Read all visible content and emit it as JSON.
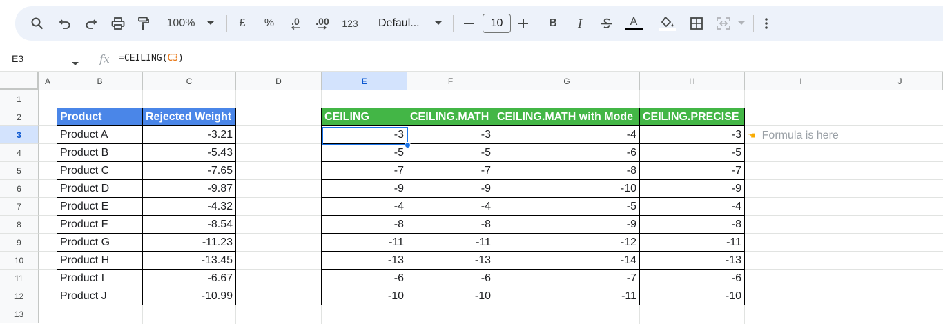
{
  "toolbar": {
    "zoom": "100%",
    "currency": "£",
    "percent": "%",
    "decrease_decimal": ".0",
    "increase_decimal": ".00",
    "number_format": "123",
    "font": "Defaul...",
    "font_size": "10",
    "bold": "B",
    "italic": "I",
    "text_color": "A"
  },
  "formula_bar": {
    "cell_ref": "E3",
    "formula_prefix": "=CEILING(",
    "formula_ref": "C3",
    "formula_suffix": ")"
  },
  "columns": [
    "A",
    "B",
    "C",
    "D",
    "E",
    "F",
    "G",
    "H",
    "I",
    "J"
  ],
  "rows": [
    "1",
    "2",
    "3",
    "4",
    "5",
    "6",
    "7",
    "8",
    "9",
    "10",
    "11",
    "12",
    "13"
  ],
  "left_table": {
    "headers": [
      "Product",
      "Rejected Weight"
    ],
    "rows": [
      [
        "Product A",
        "-3.21"
      ],
      [
        "Product B",
        "-5.43"
      ],
      [
        "Product C",
        "-7.65"
      ],
      [
        "Product D",
        "-9.87"
      ],
      [
        "Product E",
        "-4.32"
      ],
      [
        "Product F",
        "-8.54"
      ],
      [
        "Product G",
        "-11.23"
      ],
      [
        "Product H",
        "-13.45"
      ],
      [
        "Product I",
        "-6.67"
      ],
      [
        "Product J",
        "-10.99"
      ]
    ]
  },
  "right_table": {
    "headers": [
      "CEILING",
      "CEILING.MATH",
      "CEILING.MATH with Mode",
      "CEILING.PRECISE"
    ],
    "rows": [
      [
        "-3",
        "-3",
        "-4",
        "-3"
      ],
      [
        "-5",
        "-5",
        "-6",
        "-5"
      ],
      [
        "-7",
        "-7",
        "-8",
        "-7"
      ],
      [
        "-9",
        "-9",
        "-10",
        "-9"
      ],
      [
        "-4",
        "-4",
        "-5",
        "-4"
      ],
      [
        "-8",
        "-8",
        "-9",
        "-8"
      ],
      [
        "-11",
        "-11",
        "-12",
        "-11"
      ],
      [
        "-13",
        "-13",
        "-14",
        "-13"
      ],
      [
        "-6",
        "-6",
        "-7",
        "-6"
      ],
      [
        "-10",
        "-10",
        "-11",
        "-10"
      ]
    ]
  },
  "note": {
    "hand_icon": "pointing-hand-icon",
    "text": "Formula is here"
  },
  "colors": {
    "header_blue": "#4a86e8",
    "header_green": "#43b646",
    "selection": "#1a73e8",
    "toolbar_bg": "#edf2fa"
  }
}
